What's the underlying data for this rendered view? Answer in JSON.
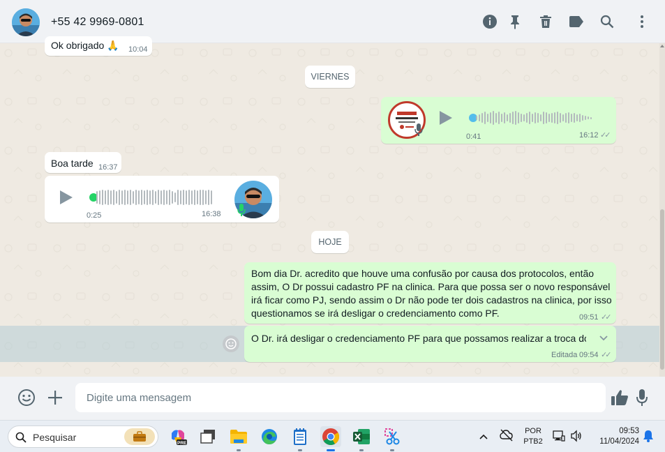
{
  "header": {
    "contact_name": "+55 42 9969-0801",
    "icons": [
      "info-icon",
      "pin-icon",
      "trash-icon",
      "label-icon",
      "search-icon",
      "menu-icon"
    ]
  },
  "messages": {
    "prev_text": "Ok obrigado 🙏",
    "prev_time": "10:04",
    "date_friday": "VIERNES",
    "audio_out_duration": "0:41",
    "audio_out_time": "16:12",
    "boa_tarde_text": "Boa tarde",
    "boa_tarde_time": "16:37",
    "audio_in_duration": "0:25",
    "audio_in_time": "16:38",
    "date_today": "HOJE",
    "long_msg_text": "Bom dia Dr. acredito que houve uma confusão por causa dos protocolos, então assim, O Dr possui cadastro PF na clinica. Para que possa ser o novo responsável irá ficar como PJ, sendo assim o Dr não pode ter dois cadastros na clinica, por isso questionamos se irá desligar o credenciamento como PF.",
    "long_msg_time": "09:51",
    "last_msg_text": "O Dr. irá desligar o credenciamento PF para que possamos realizar a troca do",
    "last_msg_edited": "Editada",
    "last_msg_time": "09:54"
  },
  "compose": {
    "placeholder": "Digite uma mensagem"
  },
  "taskbar": {
    "search_placeholder": "Pesquisar",
    "lang_top": "POR",
    "lang_bottom": "PTB2",
    "clock_time": "09:53",
    "clock_date": "11/04/2024"
  },
  "colors": {
    "outgoing": "#d9fdd3",
    "incoming": "#ffffff",
    "background": "#efeae2",
    "accent": "#25d366",
    "read_ticks": "#8696a0"
  }
}
